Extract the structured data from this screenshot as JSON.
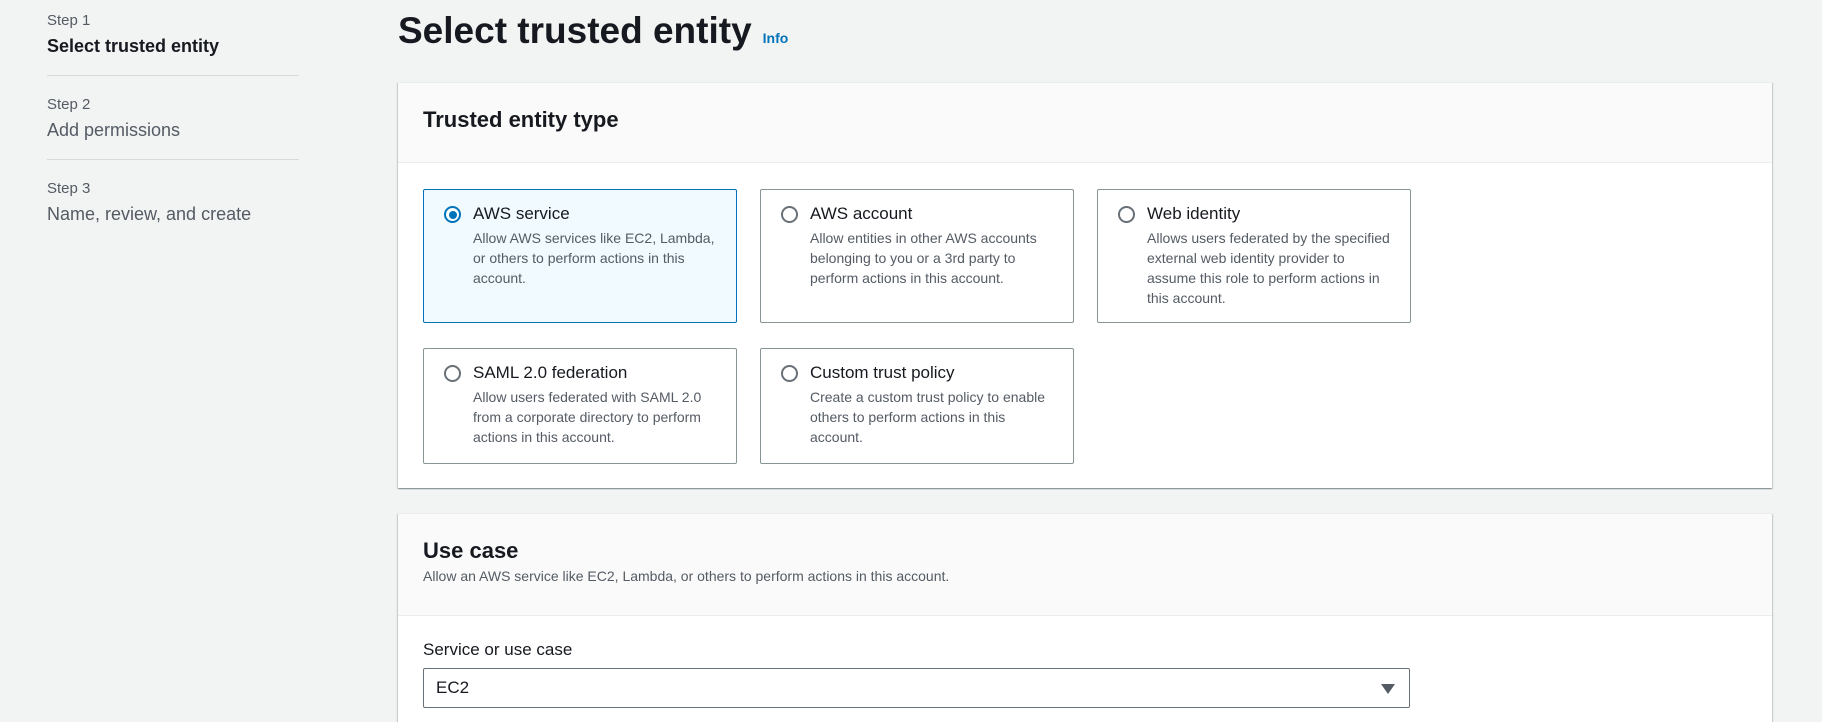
{
  "steps": [
    {
      "number": "Step 1",
      "title": "Select trusted entity",
      "active": true
    },
    {
      "number": "Step 2",
      "title": "Add permissions",
      "active": false
    },
    {
      "number": "Step 3",
      "title": "Name, review, and create",
      "active": false
    }
  ],
  "header": {
    "title": "Select trusted entity",
    "info": "Info"
  },
  "entity_panel": {
    "title": "Trusted entity type",
    "options": [
      {
        "title": "AWS service",
        "desc": "Allow AWS services like EC2, Lambda, or others to perform actions in this account.",
        "selected": true
      },
      {
        "title": "AWS account",
        "desc": "Allow entities in other AWS accounts belonging to you or a 3rd party to perform actions in this account.",
        "selected": false
      },
      {
        "title": "Web identity",
        "desc": "Allows users federated by the specified external web identity provider to assume this role to perform actions in this account.",
        "selected": false
      },
      {
        "title": "SAML 2.0 federation",
        "desc": "Allow users federated with SAML 2.0 from a corporate directory to perform actions in this account.",
        "selected": false
      },
      {
        "title": "Custom trust policy",
        "desc": "Create a custom trust policy to enable others to perform actions in this account.",
        "selected": false
      }
    ]
  },
  "usecase_panel": {
    "title": "Use case",
    "desc": "Allow an AWS service like EC2, Lambda, or others to perform actions in this account.",
    "field_label": "Service or use case",
    "selected_value": "EC2"
  },
  "colors": {
    "accent": "#0073bb",
    "selected_bg": "#f1faff",
    "page_bg": "#f2f3f3"
  }
}
